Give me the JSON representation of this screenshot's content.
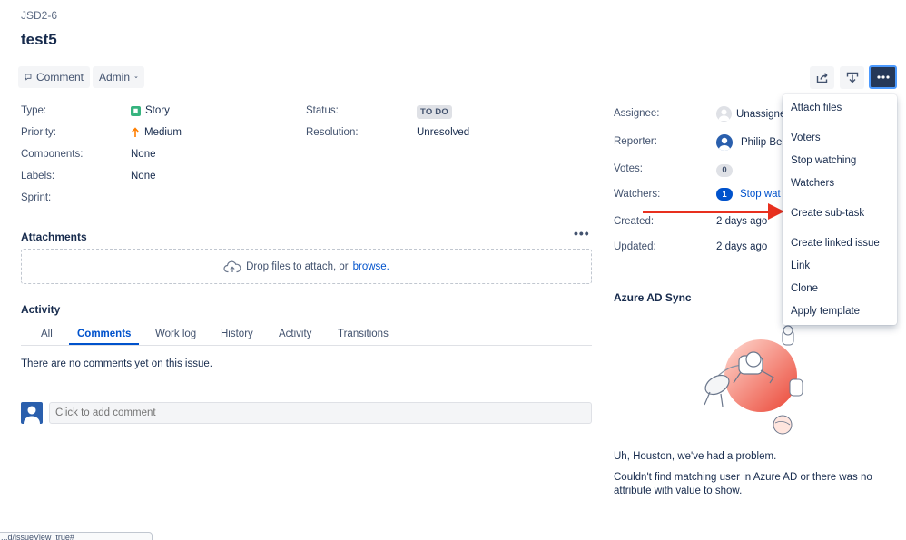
{
  "issue": {
    "key": "JSD2-6",
    "title": "test5"
  },
  "toolbar": {
    "comment_label": "Comment",
    "admin_label": "Admin",
    "share_icon": "share-icon",
    "export_icon": "export-icon",
    "more_icon": "more-icon"
  },
  "details": {
    "type_label": "Type:",
    "type_value": "Story",
    "priority_label": "Priority:",
    "priority_value": "Medium",
    "components_label": "Components:",
    "components_value": "None",
    "labels_label": "Labels:",
    "labels_value": "None",
    "sprint_label": "Sprint:",
    "sprint_value": "",
    "status_label": "Status:",
    "status_value": "TO DO",
    "resolution_label": "Resolution:",
    "resolution_value": "Unresolved"
  },
  "attachments": {
    "title": "Attachments",
    "drop_text": "Drop files to attach, or",
    "browse": "browse."
  },
  "activity": {
    "title": "Activity",
    "tabs": [
      "All",
      "Comments",
      "Work log",
      "History",
      "Activity",
      "Transitions"
    ],
    "active_tab": "Comments",
    "empty_text": "There are no comments yet on this issue.",
    "comment_placeholder": "Click to add comment"
  },
  "people": {
    "assignee_label": "Assignee:",
    "assignee_value": "Unassigne",
    "reporter_label": "Reporter:",
    "reporter_value": "Philip Be",
    "votes_label": "Votes:",
    "votes_count": "0",
    "watchers_label": "Watchers:",
    "watchers_count": "1",
    "watchers_action": "Stop wat",
    "created_label": "Created:",
    "created_value": "2 days ago",
    "updated_label": "Updated:",
    "updated_value": "2 days ago"
  },
  "azure": {
    "title": "Azure AD Sync",
    "heading": "Uh, Houston, we've had a problem.",
    "message": "Couldn't find matching user in Azure AD or there was no attribute with value to show."
  },
  "menu": {
    "items": [
      "Attach files",
      "Voters",
      "Stop watching",
      "Watchers",
      "Create sub-task",
      "Create linked issue",
      "Link",
      "Clone",
      "Apply template"
    ]
  },
  "status_bar": {
    "url": "...d/issueView_true#"
  },
  "colors": {
    "accent": "#0052cc",
    "annotation_arrow": "#e8301e",
    "story_green": "#36b37e",
    "priority_orange": "#ff7f00"
  }
}
